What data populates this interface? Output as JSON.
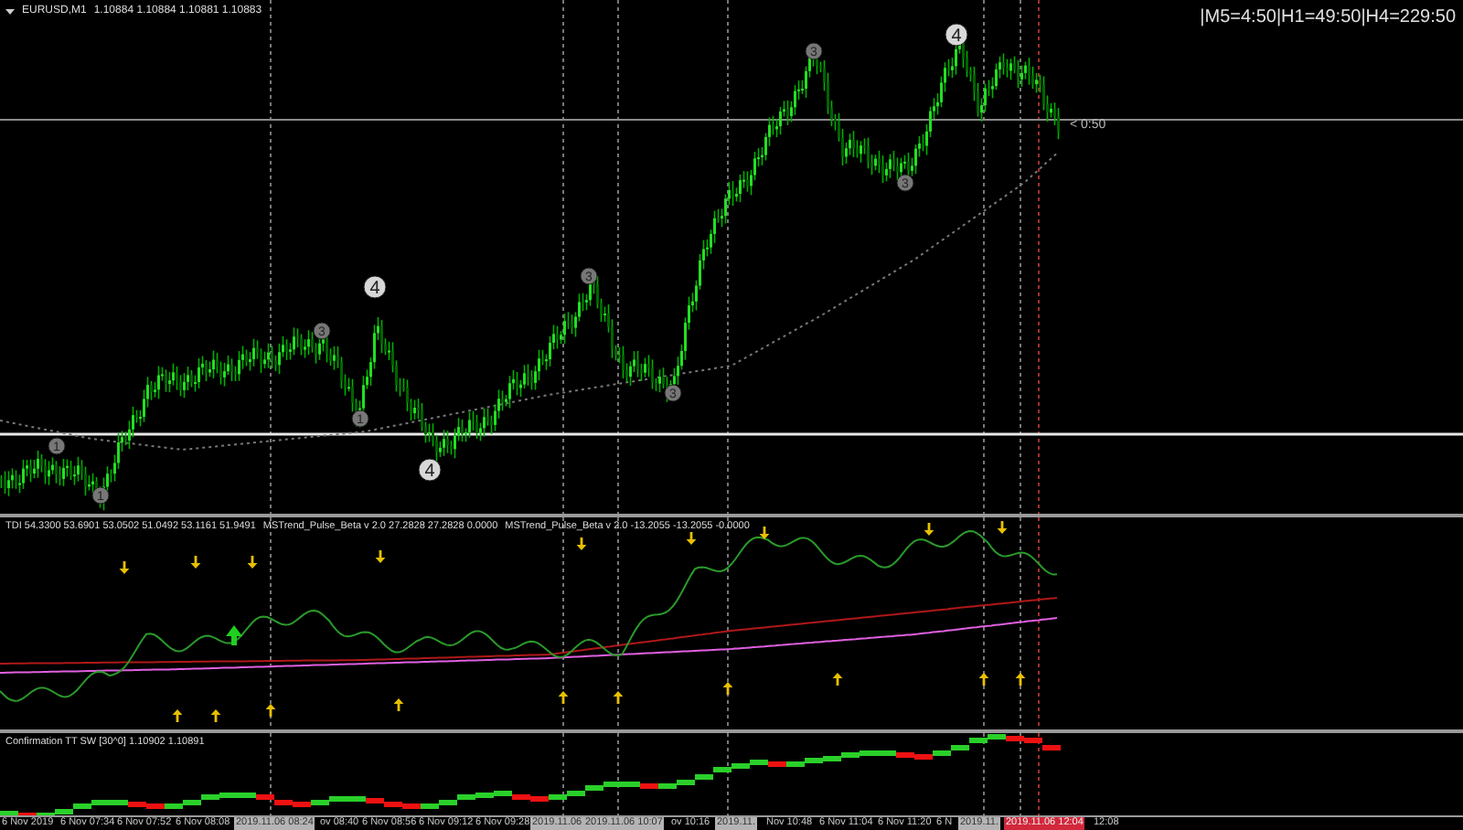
{
  "main_chart": {
    "symbol": "EURUSD,M1",
    "quote": "1.10884 1.10884 1.10881 1.10883",
    "timer": "|M5=4:50|H1=49:50|H4=229:50",
    "countdown": "< 0:50",
    "wave_labels": [
      {
        "text": "1"
      },
      {
        "text": "1"
      },
      {
        "text": "3"
      },
      {
        "text": "1"
      },
      {
        "text": "4"
      },
      {
        "text": "4"
      },
      {
        "text": "3"
      },
      {
        "text": "3"
      },
      {
        "text": "3"
      },
      {
        "text": "3"
      },
      {
        "text": "4"
      }
    ]
  },
  "indicator_panel": {
    "legend": [
      "TDI 54.3300 53.6901 53.0502 51.0492 53.1161 51.9491",
      "MSTrend_Pulse_Beta v 2.0 27.2828 27.2828 0.0000",
      "MSTrend_Pulse_Beta v 2.0 -13.2055 -13.2055 -0.0000"
    ],
    "signals": [
      {
        "kind": "down"
      },
      {
        "kind": "down"
      },
      {
        "kind": "down"
      },
      {
        "kind": "down"
      },
      {
        "kind": "down"
      },
      {
        "kind": "down"
      },
      {
        "kind": "down"
      },
      {
        "kind": "down"
      },
      {
        "kind": "down"
      },
      {
        "kind": "up"
      },
      {
        "kind": "up"
      },
      {
        "kind": "up"
      },
      {
        "kind": "up"
      },
      {
        "kind": "up"
      },
      {
        "kind": "up"
      },
      {
        "kind": "up"
      },
      {
        "kind": "up"
      },
      {
        "kind": "up"
      },
      {
        "kind": "up"
      },
      {
        "kind": "big-up"
      }
    ]
  },
  "confirmation_panel": {
    "legend": "Confirmation TT SW [30^0] 1.10902 1.10891"
  },
  "time_axis": [
    {
      "text": "6 Nov 2019",
      "kind": "plain"
    },
    {
      "text": "6 Nov 07:34",
      "kind": "plain"
    },
    {
      "text": "6 Nov 07:52",
      "kind": "plain"
    },
    {
      "text": "6 Nov 08:08",
      "kind": "plain"
    },
    {
      "text": "2019.11.06 08:24",
      "kind": "marker"
    },
    {
      "text": "ov 08:40",
      "kind": "plain"
    },
    {
      "text": "6 Nov 08:56",
      "kind": "plain"
    },
    {
      "text": "6 Nov 09:12",
      "kind": "plain"
    },
    {
      "text": "6 Nov 09:28",
      "kind": "plain"
    },
    {
      "text": "2019.11.06",
      "kind": "marker"
    },
    {
      "text": "2019.11.06 10:07",
      "kind": "marker"
    },
    {
      "text": "ov 10:16",
      "kind": "plain"
    },
    {
      "text": "2019.11.",
      "kind": "marker"
    },
    {
      "text": "Nov 10:48",
      "kind": "plain"
    },
    {
      "text": "6 Nov 11:04",
      "kind": "plain"
    },
    {
      "text": "6 Nov 11:20",
      "kind": "plain"
    },
    {
      "text": "6 N",
      "kind": "plain"
    },
    {
      "text": "2019.11.",
      "kind": "marker"
    },
    {
      "text": "2019.11.06 12:04",
      "kind": "current"
    },
    {
      "text": "12:08",
      "kind": "plain"
    }
  ]
}
